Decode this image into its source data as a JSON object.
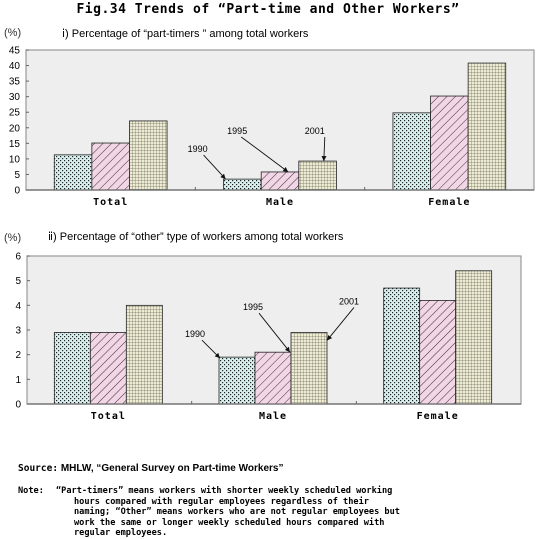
{
  "figure": {
    "title": "Fig.34  Trends of “Part-time and Other Workers”"
  },
  "colors": {
    "plot_bg": "#eeeeee",
    "series_1990": "#d8eff0",
    "series_1995": "#f2d6e6",
    "series_2001": "#eeecd0",
    "border": "#999999"
  },
  "chart_data": [
    {
      "type": "bar",
      "subtitle": "ⅰ) Percentage of “part-timers ” among total workers",
      "ylabel": "(%)",
      "xlabel": "",
      "ylim": [
        0,
        45
      ],
      "yticks": [
        0,
        5,
        10,
        15,
        20,
        25,
        30,
        35,
        40,
        45
      ],
      "categories": [
        "Total",
        "Male",
        "Female"
      ],
      "series": [
        {
          "name": "1990",
          "pattern": "dots",
          "values": [
            11.3,
            3.5,
            24.8
          ]
        },
        {
          "name": "1995",
          "pattern": "diagonal",
          "values": [
            15.1,
            5.8,
            30.2
          ]
        },
        {
          "name": "2001",
          "pattern": "grid",
          "values": [
            22.2,
            9.3,
            40.8
          ]
        }
      ],
      "annotations": [
        {
          "text": "1990",
          "category": "Male",
          "series": "1990"
        },
        {
          "text": "1995",
          "category": "Male",
          "series": "1995"
        },
        {
          "text": "2001",
          "category": "Male",
          "series": "2001"
        }
      ],
      "grid": false,
      "legend": "none"
    },
    {
      "type": "bar",
      "subtitle": "ⅱ) Percentage of “other” type of workers among total workers",
      "ylabel": "(%)",
      "xlabel": "",
      "ylim": [
        0,
        6
      ],
      "yticks": [
        0,
        1,
        2,
        3,
        4,
        5,
        6
      ],
      "categories": [
        "Total",
        "Male",
        "Female"
      ],
      "series": [
        {
          "name": "1990",
          "pattern": "dots",
          "values": [
            2.9,
            1.9,
            4.7
          ]
        },
        {
          "name": "1995",
          "pattern": "diagonal",
          "values": [
            2.9,
            2.1,
            4.2
          ]
        },
        {
          "name": "2001",
          "pattern": "grid",
          "values": [
            4.0,
            2.9,
            5.4
          ]
        }
      ],
      "annotations": [
        {
          "text": "1990",
          "category": "Male",
          "series": "1990"
        },
        {
          "text": "1995",
          "category": "Male",
          "series": "1995"
        },
        {
          "text": "2001",
          "category": "Male",
          "series": "2001"
        }
      ],
      "grid": false,
      "legend": "none"
    }
  ],
  "source": {
    "label": "Source:",
    "text": "MHLW, “General Survey on Part-time Workers”"
  },
  "note": {
    "label": "Note:",
    "lines": [
      "“Part-timers” means workers with shorter weekly scheduled working",
      "hours compared with regular employees regardless of their",
      "naming; “Other” means workers who are not regular employees but",
      "work the same or longer weekly scheduled hours compared with",
      "regular employees."
    ]
  }
}
